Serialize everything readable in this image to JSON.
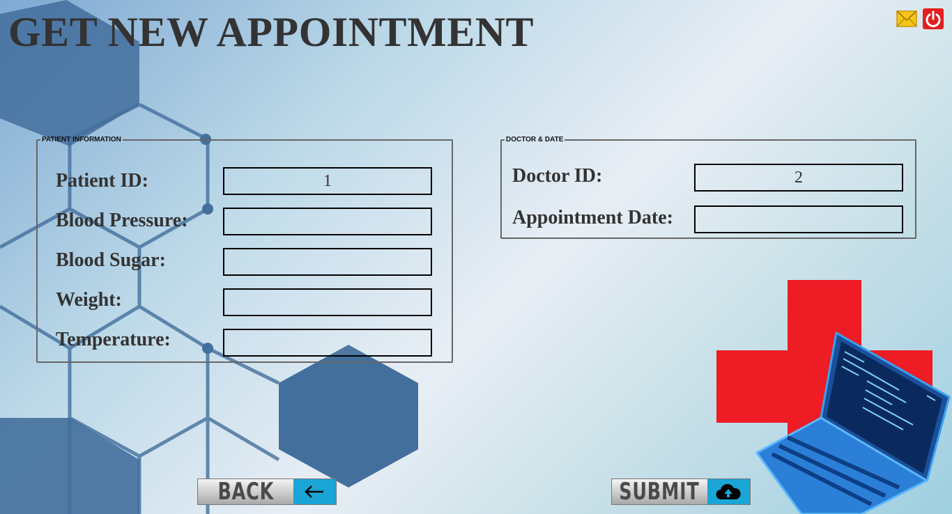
{
  "header": {
    "title": "GET NEW APPOINTMENT"
  },
  "icons": {
    "mail": "mail-icon",
    "power": "power-icon",
    "back_arrow": "arrow-left-icon",
    "upload": "cloud-upload-icon"
  },
  "patient_panel": {
    "legend": "PATIENT INFORMATION",
    "fields": {
      "patient_id": {
        "label": "Patient ID:",
        "value": "1"
      },
      "blood_pressure": {
        "label": "Blood Pressure:",
        "value": ""
      },
      "blood_sugar": {
        "label": "Blood Sugar:",
        "value": ""
      },
      "weight": {
        "label": "Weight:",
        "value": ""
      },
      "temperature": {
        "label": "Temperature:",
        "value": ""
      }
    }
  },
  "doctor_panel": {
    "legend": "DOCTOR & DATE",
    "fields": {
      "doctor_id": {
        "label": "Doctor ID:",
        "value": "2"
      },
      "appointment_date": {
        "label": "Appointment Date:",
        "value": ""
      }
    }
  },
  "buttons": {
    "back_label": "BACK",
    "submit_label": "SUBMIT"
  },
  "colors": {
    "accent": "#1aa5d6",
    "cross_red": "#ee1c25",
    "title": "#333333",
    "hex_blue": "#436f9c"
  }
}
